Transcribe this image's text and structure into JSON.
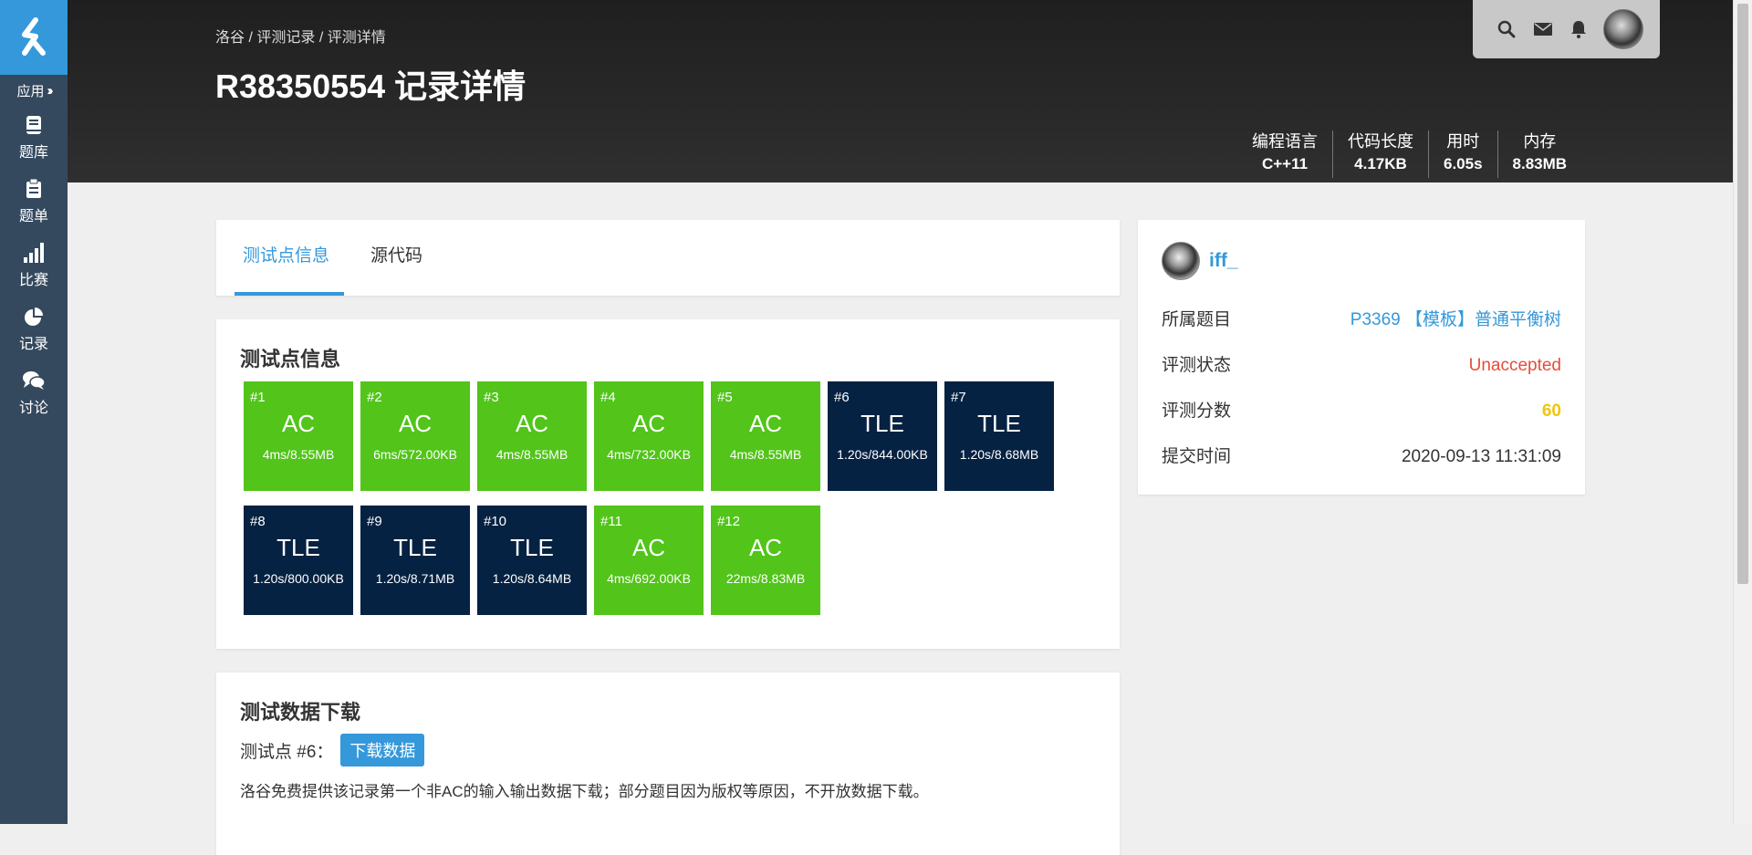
{
  "sidebar": {
    "apps_label": "应用",
    "items": [
      {
        "label": "题库",
        "icon": "book-icon"
      },
      {
        "label": "题单",
        "icon": "clipboard-icon"
      },
      {
        "label": "比赛",
        "icon": "bar-chart-icon"
      },
      {
        "label": "记录",
        "icon": "pie-chart-icon"
      },
      {
        "label": "讨论",
        "icon": "chat-icon"
      }
    ]
  },
  "header": {
    "breadcrumb": [
      "洛谷",
      "评测记录",
      "评测详情"
    ],
    "title": "R38350554 记录详情",
    "stats": [
      {
        "label": "编程语言",
        "value": "C++11"
      },
      {
        "label": "代码长度",
        "value": "4.17KB"
      },
      {
        "label": "用时",
        "value": "6.05s"
      },
      {
        "label": "内存",
        "value": "8.83MB"
      }
    ]
  },
  "tabs": {
    "testcases": "测试点信息",
    "source": "源代码"
  },
  "testcases_section": {
    "title": "测试点信息",
    "cases": [
      {
        "num": "#1",
        "status": "AC",
        "detail": "4ms/8.55MB"
      },
      {
        "num": "#2",
        "status": "AC",
        "detail": "6ms/572.00KB"
      },
      {
        "num": "#3",
        "status": "AC",
        "detail": "4ms/8.55MB"
      },
      {
        "num": "#4",
        "status": "AC",
        "detail": "4ms/732.00KB"
      },
      {
        "num": "#5",
        "status": "AC",
        "detail": "4ms/8.55MB"
      },
      {
        "num": "#6",
        "status": "TLE",
        "detail": "1.20s/844.00KB"
      },
      {
        "num": "#7",
        "status": "TLE",
        "detail": "1.20s/8.68MB"
      },
      {
        "num": "#8",
        "status": "TLE",
        "detail": "1.20s/800.00KB"
      },
      {
        "num": "#9",
        "status": "TLE",
        "detail": "1.20s/8.71MB"
      },
      {
        "num": "#10",
        "status": "TLE",
        "detail": "1.20s/8.64MB"
      },
      {
        "num": "#11",
        "status": "AC",
        "detail": "4ms/692.00KB"
      },
      {
        "num": "#12",
        "status": "AC",
        "detail": "22ms/8.83MB"
      }
    ]
  },
  "download_section": {
    "title": "测试数据下载",
    "row_label": "测试点 #6：",
    "button": "下载数据",
    "note": "洛谷免费提供该记录第一个非AC的输入输出数据下载；部分题目因为版权等原因，不开放数据下载。"
  },
  "info": {
    "username": "iff_",
    "rows": [
      {
        "key": "所属题目",
        "value": "P3369 【模板】普通平衡树"
      },
      {
        "key": "评测状态",
        "value": "Unaccepted"
      },
      {
        "key": "评测分数",
        "value": "60"
      },
      {
        "key": "提交时间",
        "value": "2020-09-13 11:31:09"
      }
    ]
  },
  "colors": {
    "ac": "#52c41a",
    "tle": "#052242",
    "accent": "#3498db",
    "unaccepted": "#e74c3c",
    "score": "#f1c40f"
  }
}
